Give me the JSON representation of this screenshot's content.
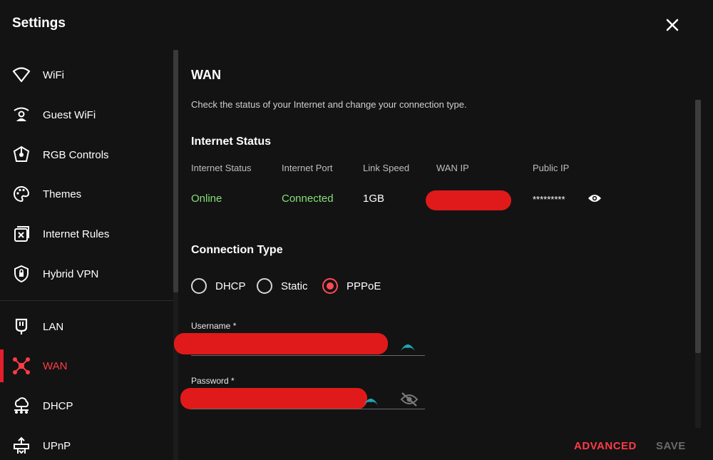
{
  "window": {
    "title": "Settings"
  },
  "sidebar": {
    "items": [
      {
        "label": "WiFi",
        "icon": "wifi-icon"
      },
      {
        "label": "Guest WiFi",
        "icon": "guest-wifi-icon"
      },
      {
        "label": "RGB Controls",
        "icon": "rgb-icon"
      },
      {
        "label": "Themes",
        "icon": "palette-icon"
      },
      {
        "label": "Internet Rules",
        "icon": "internet-rules-icon"
      },
      {
        "label": "Hybrid VPN",
        "icon": "shield-icon"
      },
      {
        "label": "LAN",
        "icon": "lan-icon"
      },
      {
        "label": "WAN",
        "icon": "wan-icon",
        "active": true
      },
      {
        "label": "DHCP",
        "icon": "dhcp-icon"
      },
      {
        "label": "UPnP",
        "icon": "upnp-icon"
      }
    ]
  },
  "main": {
    "title": "WAN",
    "description": "Check the status of your Internet and change your connection type.",
    "internet_status": {
      "heading": "Internet Status",
      "columns": {
        "status": "Internet Status",
        "port": "Internet Port",
        "speed": "Link Speed",
        "wan_ip": "WAN IP",
        "public_ip": "Public IP"
      },
      "values": {
        "status": "Online",
        "port": "Connected",
        "speed": "1GB",
        "public_ip": "*********"
      }
    },
    "connection_type": {
      "heading": "Connection Type",
      "options": [
        "DHCP",
        "Static",
        "PPPoE"
      ],
      "selected": "PPPoE"
    },
    "username": {
      "label": "Username *"
    },
    "password": {
      "label": "Password *"
    }
  },
  "footer": {
    "advanced_label": "ADVANCED",
    "save_label": "SAVE"
  },
  "colors": {
    "accent": "#ff3b46",
    "online": "#86e07a",
    "background": "#131313",
    "teal": "#1fa6b3"
  }
}
